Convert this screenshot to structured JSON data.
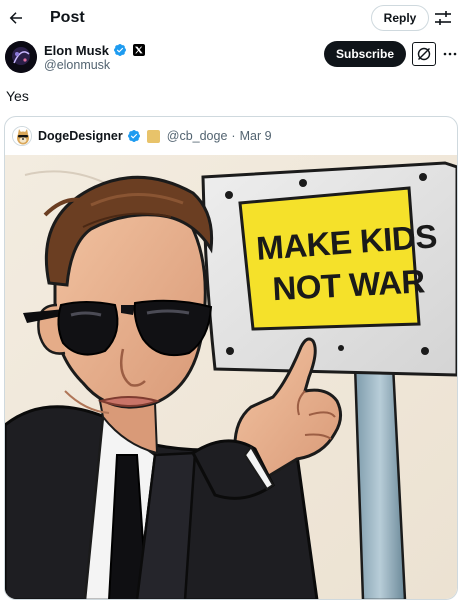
{
  "header": {
    "title": "Post",
    "reply_label": "Reply"
  },
  "author": {
    "name": "Elon Musk",
    "handle": "@elonmusk",
    "subscribe_label": "Subscribe"
  },
  "post": {
    "text": "Yes"
  },
  "quote": {
    "name": "DogeDesigner",
    "handle": "@cb_doge",
    "separator": "·",
    "date": "Mar 9",
    "image": {
      "sign_line_1": "MAKE KIDS",
      "sign_line_2": "NOT WAR"
    }
  },
  "colors": {
    "verified": "#1d9bf0",
    "sign_yellow": "#f5e12a",
    "text_primary": "#0f1419",
    "text_secondary": "#536471"
  },
  "icons": {
    "back": "arrow-left-icon",
    "settings": "sliders-icon",
    "verified": "verified-badge-icon",
    "affiliate": "x-logo-icon",
    "grok": "grok-icon",
    "more": "more-dots-icon"
  }
}
